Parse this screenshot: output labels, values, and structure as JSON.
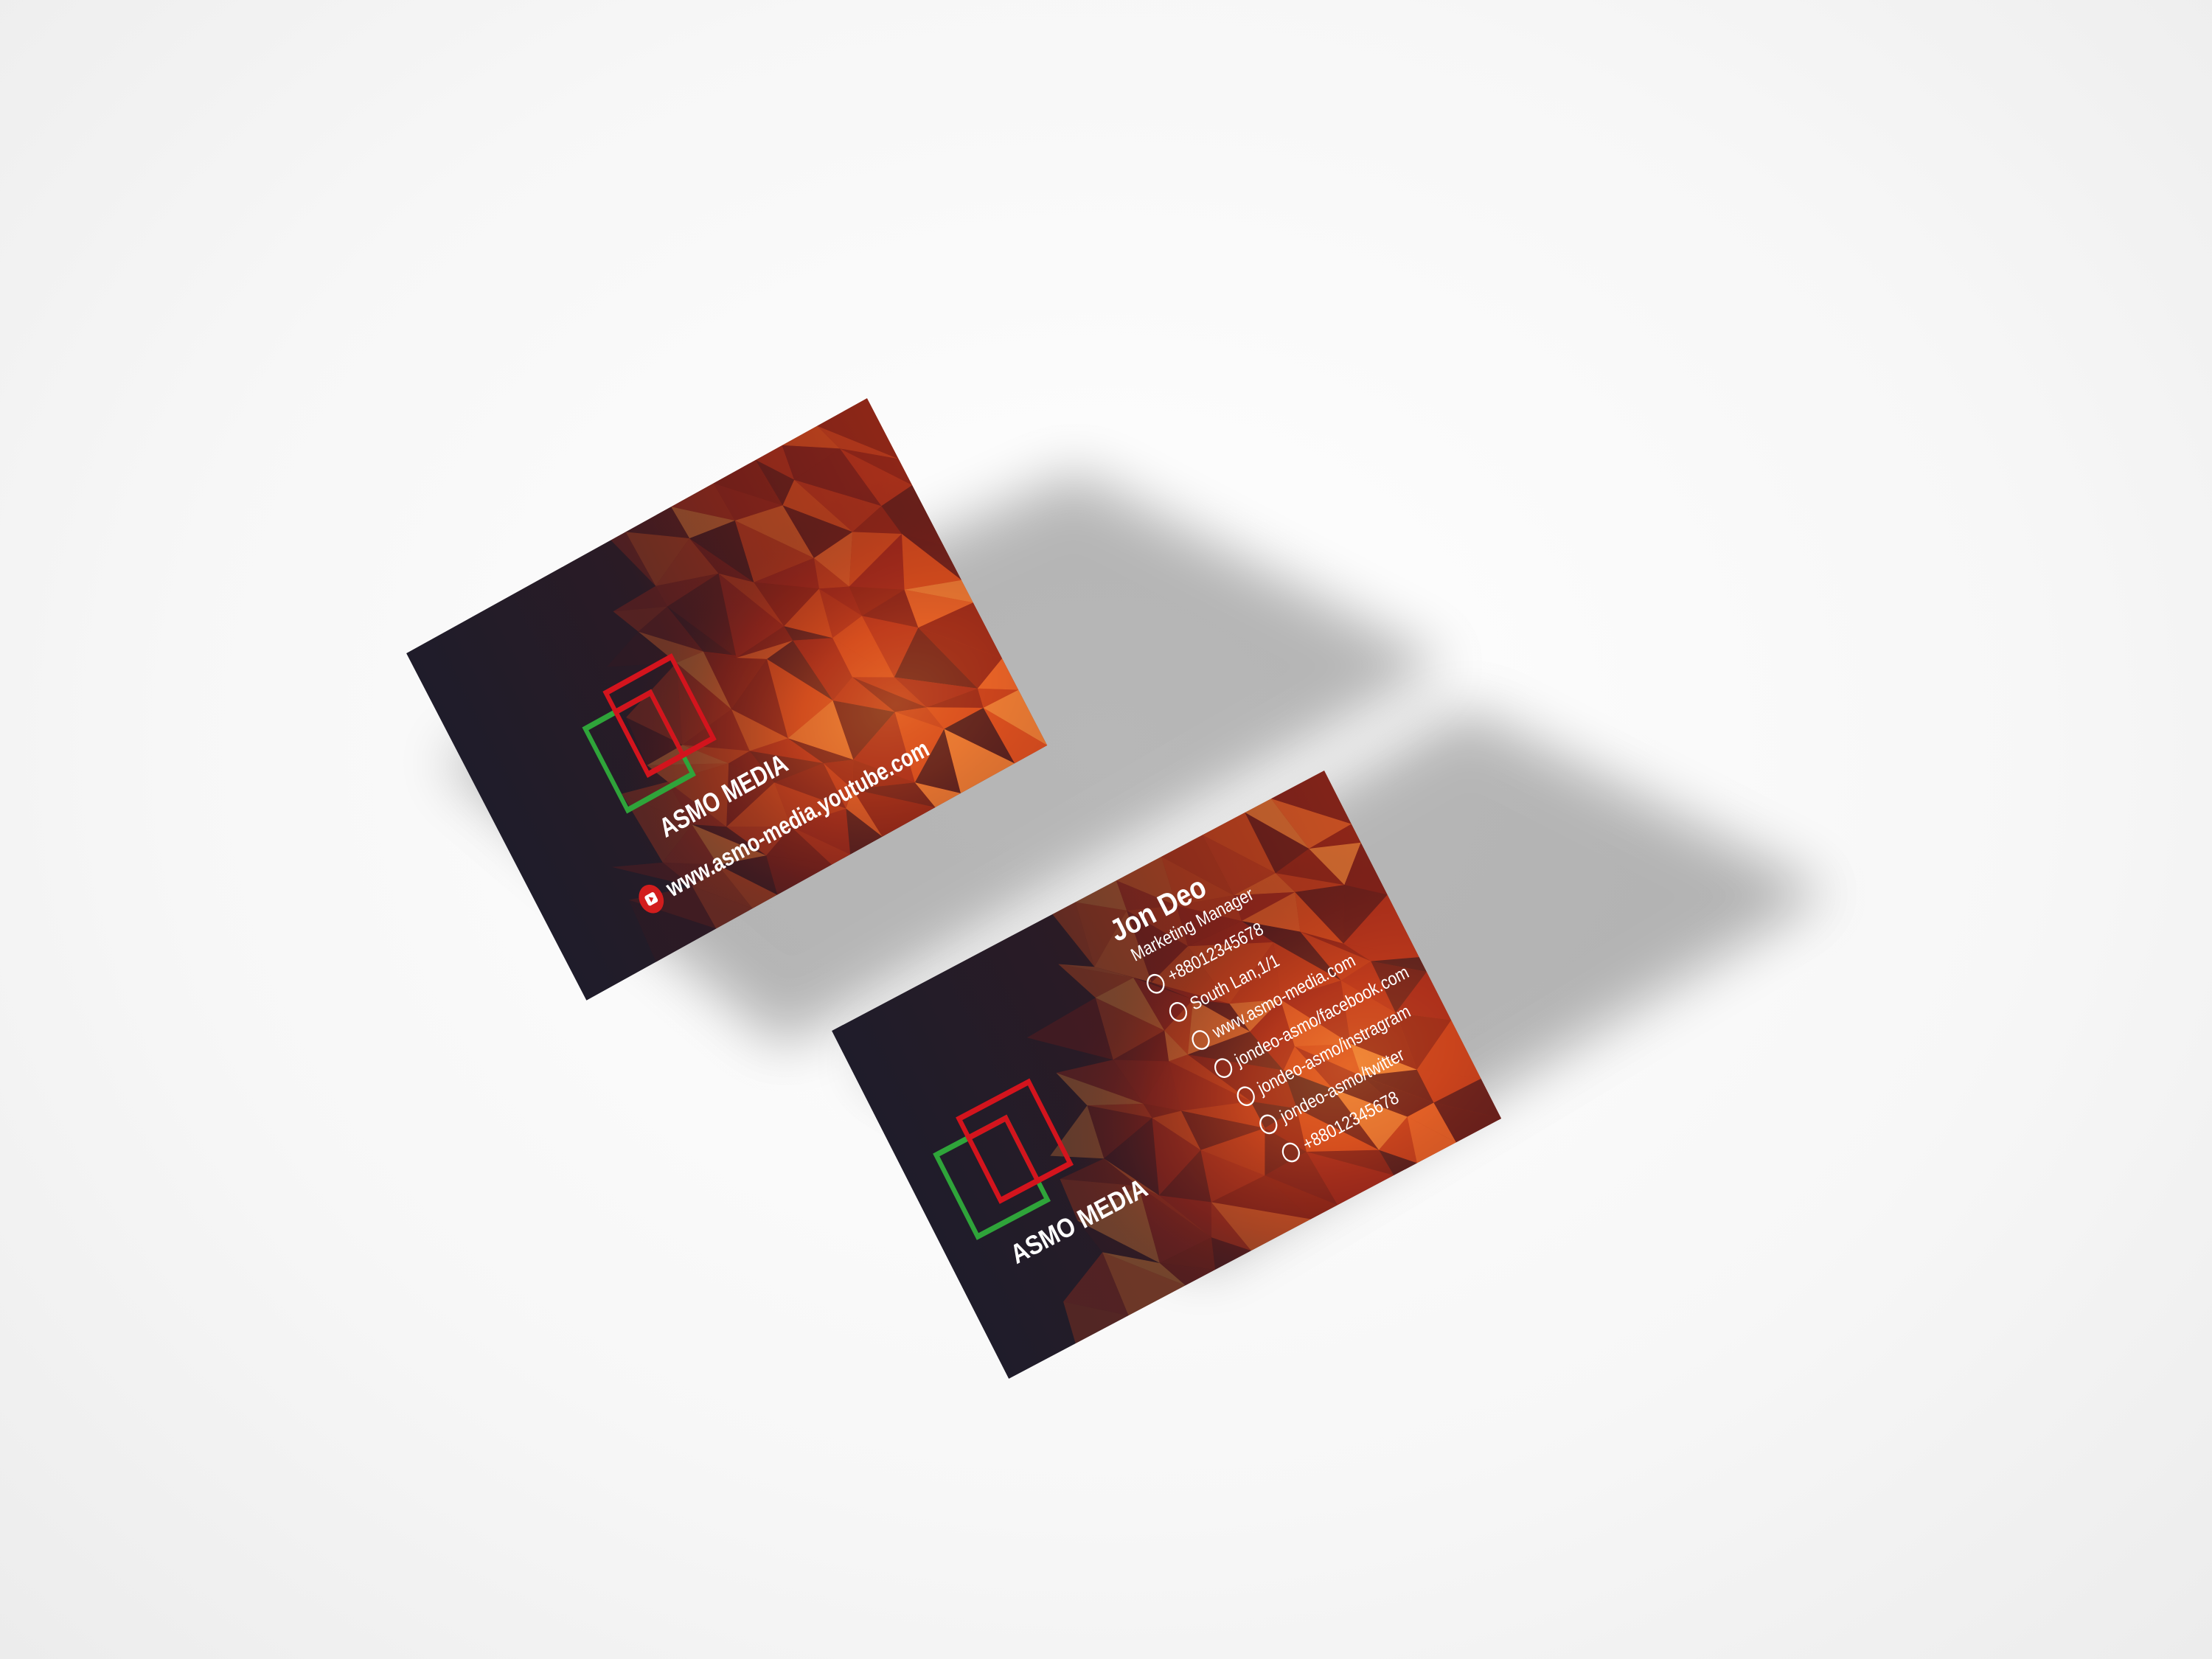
{
  "colors": {
    "card_dark": "#1f1c2a",
    "card_mid": "#4a1a1c",
    "poly_red": "#a1281b",
    "poly_orange": "#e0531f",
    "poly_light": "#f38a3a",
    "logo_green": "#2fa43a",
    "logo_red": "#d3141d",
    "text_white": "#ffffff",
    "youtube_red": "#d21d1d"
  },
  "front_card": {
    "brand_name": "ASMO MEDIA",
    "youtube_url": "www.asmo-media.youtube.com",
    "logo_icon": "overlapping-squares-logo",
    "youtube_icon": "youtube-play-icon"
  },
  "back_card": {
    "brand_name": "ASMO MEDIA",
    "logo_icon": "overlapping-squares-logo",
    "name": "Jon Deo",
    "title": "Marketing Manager",
    "contacts": [
      {
        "icon": "phone-icon",
        "text": "+88012345678"
      },
      {
        "icon": "location-pin-icon",
        "text": "South Lan,1/1"
      },
      {
        "icon": "cursor-icon",
        "text": "www.asmo-media.com"
      },
      {
        "icon": "facebook-icon",
        "text": "jondeo-asmo/facebook.com"
      },
      {
        "icon": "instagram-icon",
        "text": "jondeo-asmo/instragram"
      },
      {
        "icon": "twitter-icon",
        "text": "jondeo-asmo/twitter"
      },
      {
        "icon": "whatsapp-icon",
        "text": "+88012345678"
      }
    ]
  }
}
